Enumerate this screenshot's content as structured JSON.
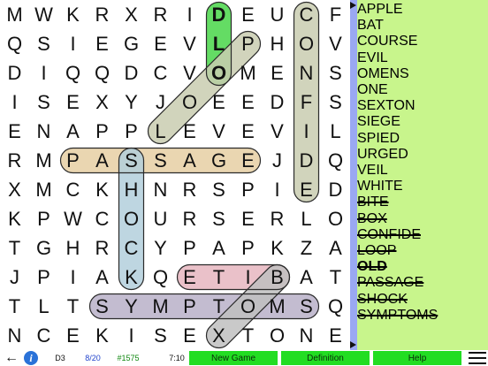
{
  "grid": {
    "rows": [
      "MWKRXRIDEUCF",
      "QSIEGEVLPHOV",
      "DIQQDCVOMENS",
      "ISEXYJOEEDFS",
      "ENAPPLEVEVIL",
      "RMPASSAGEJDQ",
      "XMCKHNRSPIED",
      "KPWCOURSERLO",
      "TGHRCYPAPKZA",
      "JPIAKQETIBAT",
      "TLTSYMPTOMSQ",
      "NCEKISEXTONE"
    ]
  },
  "found_highlights": [
    {
      "word": "OLD",
      "from": [
        2,
        7
      ],
      "to": [
        0,
        7
      ],
      "color": "#49d649",
      "bold": true
    },
    {
      "word": "CONFIDE",
      "from": [
        0,
        10
      ],
      "to": [
        6,
        10
      ],
      "color": "#c9cdb0",
      "bold": false
    },
    {
      "word": "LOOP",
      "from": [
        4,
        5
      ],
      "to": [
        1,
        8
      ],
      "color": "#c9cdb0",
      "bold": false
    },
    {
      "word": "PASSAGE",
      "from": [
        5,
        2
      ],
      "to": [
        5,
        8
      ],
      "color": "#e6cfa3",
      "bold": false
    },
    {
      "word": "SHOCK",
      "from": [
        5,
        4
      ],
      "to": [
        9,
        4
      ],
      "color": "#b3cfdc",
      "bold": false
    },
    {
      "word": "BITE",
      "from": [
        9,
        9
      ],
      "to": [
        9,
        6
      ],
      "color": "#e6b6c0",
      "bold": false
    },
    {
      "word": "SYMPTOMS",
      "from": [
        10,
        3
      ],
      "to": [
        10,
        10
      ],
      "color": "#b8b0c8",
      "bold": false
    },
    {
      "word": "BOX",
      "from": [
        9,
        9
      ],
      "to": [
        11,
        7
      ],
      "color": "#bfbfbf",
      "bold": false
    }
  ],
  "word_list": [
    {
      "text": "APPLE",
      "found": false,
      "bold": false
    },
    {
      "text": "BAT",
      "found": false,
      "bold": false
    },
    {
      "text": "COURSE",
      "found": false,
      "bold": false
    },
    {
      "text": "EVIL",
      "found": false,
      "bold": false
    },
    {
      "text": "OMENS",
      "found": false,
      "bold": false
    },
    {
      "text": "ONE",
      "found": false,
      "bold": false
    },
    {
      "text": "SEXTON",
      "found": false,
      "bold": false
    },
    {
      "text": "SIEGE",
      "found": false,
      "bold": false
    },
    {
      "text": "SPIED",
      "found": false,
      "bold": false
    },
    {
      "text": "URGED",
      "found": false,
      "bold": false
    },
    {
      "text": "VEIL",
      "found": false,
      "bold": false
    },
    {
      "text": "WHITE",
      "found": false,
      "bold": false
    },
    {
      "text": "BITE",
      "found": true,
      "bold": false
    },
    {
      "text": "BOX",
      "found": true,
      "bold": false
    },
    {
      "text": "CONFIDE",
      "found": true,
      "bold": false
    },
    {
      "text": "LOOP",
      "found": true,
      "bold": false
    },
    {
      "text": "OLD",
      "found": true,
      "bold": true
    },
    {
      "text": "PASSAGE",
      "found": true,
      "bold": false
    },
    {
      "text": "SHOCK",
      "found": true,
      "bold": false
    },
    {
      "text": "SYMPTOMS",
      "found": true,
      "bold": false
    }
  ],
  "status": {
    "back_icon": "left-arrow-icon",
    "info_icon": "info-icon",
    "info_glyph": "i",
    "level": "D3",
    "progress": "8/20",
    "puzzle_number": "#1575",
    "timer": "7:10"
  },
  "buttons": {
    "new_game": "New Game",
    "definition": "Definition",
    "help": "Help"
  },
  "colors": {
    "panel_background": "#c8f58c",
    "panel_strip": "#9aa8f2",
    "button_green": "#22dd22"
  }
}
